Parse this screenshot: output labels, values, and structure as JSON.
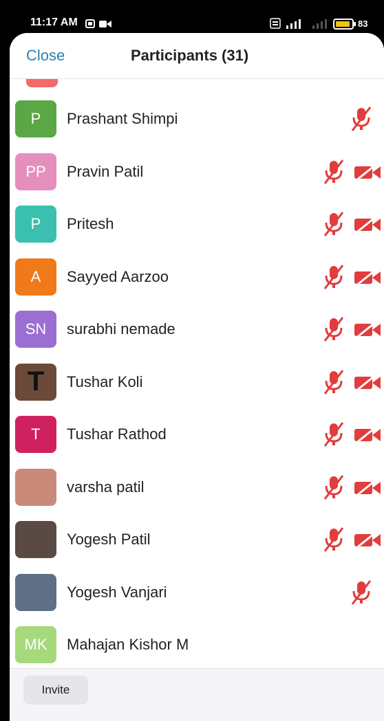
{
  "status_bar": {
    "time": "11:17 AM",
    "battery": "83"
  },
  "header": {
    "close_label": "Close",
    "title": "Participants (31)"
  },
  "colors": {
    "accent": "#2d7fb6",
    "muted_icon": "#e23c3c"
  },
  "participants": [
    {
      "initials": "P",
      "name": "Prashant Shimpi",
      "avatar_color": "#5aa745",
      "mic": "muted-mic-icon",
      "video": ""
    },
    {
      "initials": "PP",
      "name": "Pravin Patil",
      "avatar_color": "#e58fbd",
      "mic": "muted-mic-icon",
      "video": "video-off-icon"
    },
    {
      "initials": "P",
      "name": "Pritesh",
      "avatar_color": "#3bbfae",
      "mic": "muted-mic-icon",
      "video": "video-off-icon"
    },
    {
      "initials": "A",
      "name": "Sayyed Aarzoo",
      "avatar_color": "#f07a1a",
      "mic": "muted-mic-icon",
      "video": "video-off-icon"
    },
    {
      "initials": "SN",
      "name": "surabhi nemade",
      "avatar_color": "#9b6fd1",
      "mic": "muted-mic-icon",
      "video": "video-off-icon"
    },
    {
      "initials": "T",
      "name": "Tushar Koli",
      "avatar_color": "#6b4a3a",
      "mic": "muted-mic-icon",
      "video": "video-off-icon"
    },
    {
      "initials": "T",
      "name": "Tushar Rathod",
      "avatar_color": "#d0215f",
      "mic": "muted-mic-icon",
      "video": "video-off-icon"
    },
    {
      "initials": "",
      "name": "varsha patil",
      "avatar_color": "#c98a7a",
      "mic": "muted-mic-icon",
      "video": "video-off-icon"
    },
    {
      "initials": "",
      "name": "Yogesh Patil",
      "avatar_color": "#5a4a44",
      "mic": "muted-mic-icon",
      "video": "video-off-icon"
    },
    {
      "initials": "",
      "name": "Yogesh Vanjari",
      "avatar_color": "#5e6f86",
      "mic": "muted-mic-icon",
      "video": ""
    },
    {
      "initials": "MK",
      "name": "Mahajan Kishor M",
      "avatar_color": "#a6d97c",
      "mic": "",
      "video": ""
    }
  ],
  "footer": {
    "invite_label": "Invite"
  }
}
